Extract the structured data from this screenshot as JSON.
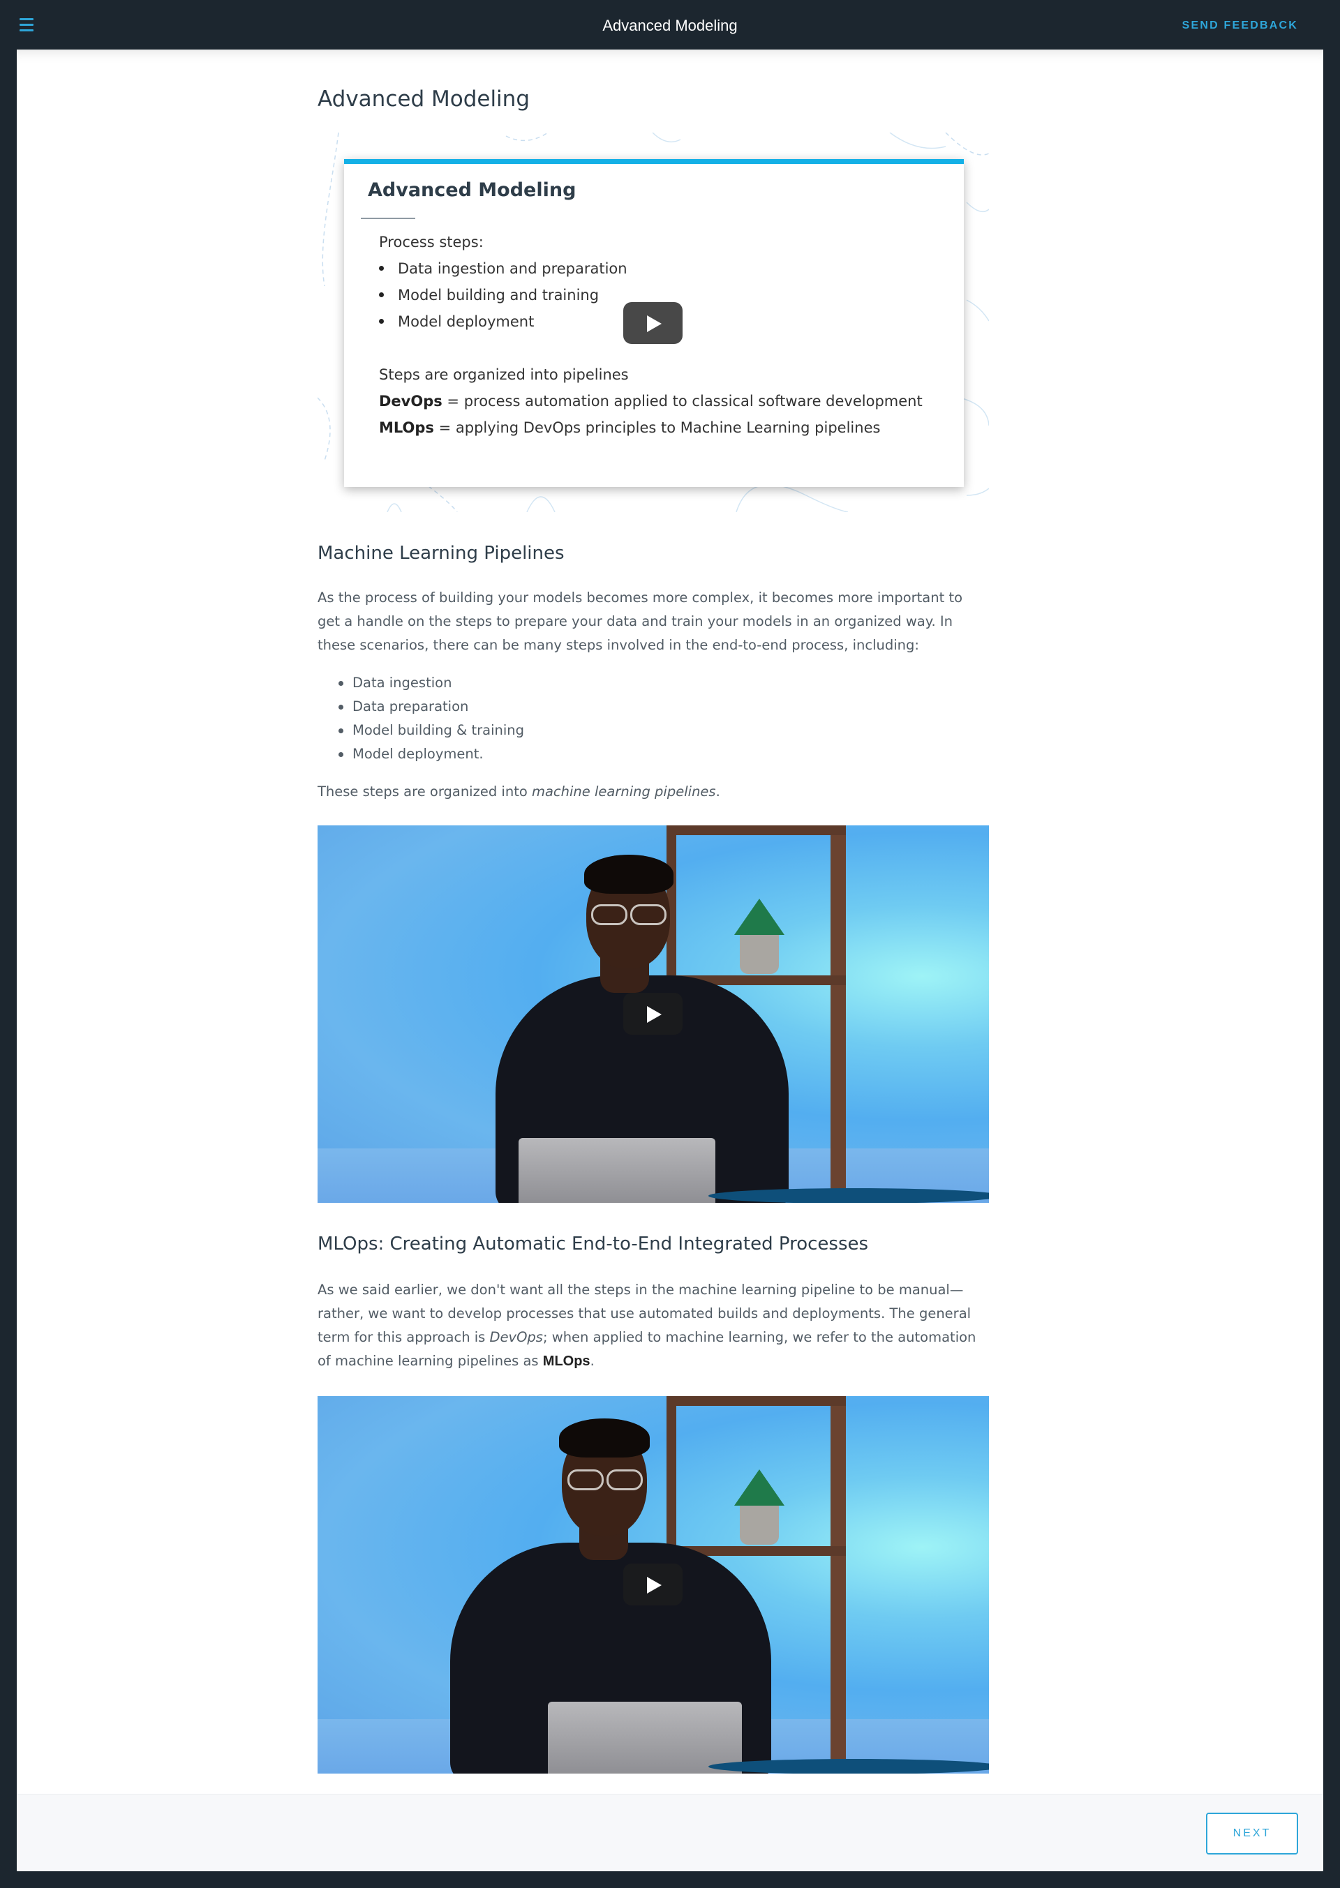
{
  "topbar": {
    "title": "Advanced Modeling",
    "feedback_label": "SEND FEEDBACK"
  },
  "page": {
    "title": "Advanced Modeling"
  },
  "slide": {
    "title": "Advanced Modeling",
    "intro": "Process steps:",
    "steps": [
      "Data ingestion and preparation",
      "Model building and training",
      "Model deployment"
    ],
    "line1": "Steps are organized into pipelines",
    "devops_term": "DevOps",
    "devops_def": " = process automation applied to classical software development",
    "mlops_term": "MLOps",
    "mlops_def": " = applying DevOps principles to Machine Learning pipelines"
  },
  "section1": {
    "heading": "Machine Learning Pipelines",
    "paragraph": "As the process of building your models becomes more complex, it becomes more important to get a handle on the steps to prepare your data and train your models in an organized way. In these scenarios, there can be many steps involved in the end-to-end process, including:",
    "items": [
      "Data ingestion",
      "Data preparation",
      "Model building & training",
      "Model deployment."
    ],
    "closing_prefix": "These steps are organized into ",
    "closing_em": "machine learning pipelines",
    "closing_suffix": "."
  },
  "section2": {
    "heading": "MLOps: Creating Automatic End-to-End Integrated Processes",
    "p_part1": "As we said earlier, we don't want all the steps in the machine learning pipeline to be manual—rather, we want to develop processes that use automated builds and deployments. The general term for this approach is ",
    "p_em": "DevOps",
    "p_part2": "; when applied to machine learning, we refer to the automation of machine learning pipelines as ",
    "p_bold": "MLOps",
    "p_part3": "."
  },
  "footer": {
    "next_label": "NEXT"
  },
  "colors": {
    "accent": "#2ea6d9",
    "topbar_bg": "#1c262f",
    "slide_accent": "#14b0e6",
    "heading": "#2e3d49",
    "body_text": "#525c65"
  },
  "icons": {
    "menu": "hamburger-menu-icon",
    "play": "play-icon"
  }
}
